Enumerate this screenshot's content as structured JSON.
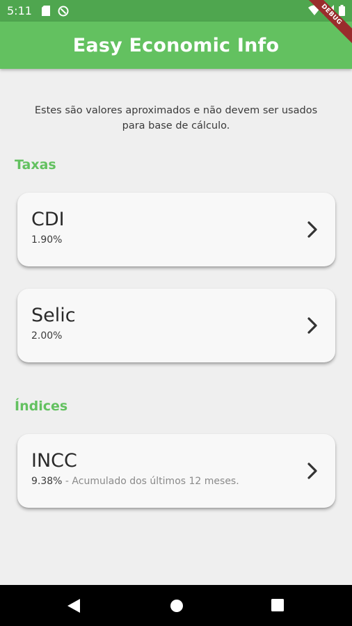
{
  "status_bar": {
    "time": "5:11"
  },
  "app_bar": {
    "title": "Easy Economic Info",
    "debug_label": "DEBUG"
  },
  "disclaimer": "Estes são valores aproximados e não devem ser usados para base de cálculo.",
  "sections": [
    {
      "title": "Taxas",
      "items": [
        {
          "name": "CDI",
          "value": "1.90%",
          "note": ""
        },
        {
          "name": "Selic",
          "value": "2.00%",
          "note": ""
        }
      ]
    },
    {
      "title": "Índices",
      "items": [
        {
          "name": "INCC",
          "value": "9.38%",
          "note": " - Acumulado dos últimos 12 meses."
        }
      ]
    }
  ],
  "colors": {
    "status_bar": "#4fa64f",
    "app_bar": "#63c160",
    "accent": "#63c160",
    "background": "#efefef",
    "card": "#f8f8f8"
  },
  "icons": [
    "sd-card-icon",
    "sync-icon",
    "wifi-icon",
    "signal-icon",
    "battery-icon",
    "chevron-right-icon",
    "back-icon",
    "home-icon",
    "recents-icon"
  ]
}
